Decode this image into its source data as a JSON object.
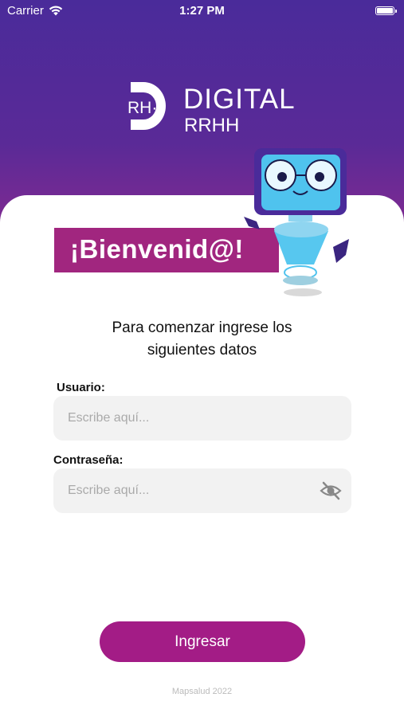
{
  "status_bar": {
    "carrier": "Carrier",
    "time": "1:27 PM"
  },
  "brand": {
    "mark": "RH·",
    "name_line1": "DIGITAL",
    "name_line2": "RRHH"
  },
  "welcome": {
    "banner": "¡Bienvenid@!",
    "intro_line1": "Para comenzar ingrese los",
    "intro_line2": "siguientes datos"
  },
  "form": {
    "user_label": "Usuario:",
    "user_placeholder": "Escribe aquí...",
    "password_label": "Contraseña:",
    "password_placeholder": "Escribe aquí..."
  },
  "actions": {
    "submit_label": "Ingresar"
  },
  "footer": {
    "text": "Mapsalud 2022"
  },
  "colors": {
    "brand_purple": "#4a2b9a",
    "magenta": "#a31c86",
    "banner": "#a1267f",
    "field_bg": "#f2f2f2"
  },
  "icons": {
    "wifi": "wifi-icon",
    "battery": "battery-icon",
    "password_visibility": "eye-off-icon",
    "mascot": "robot-mascot"
  }
}
